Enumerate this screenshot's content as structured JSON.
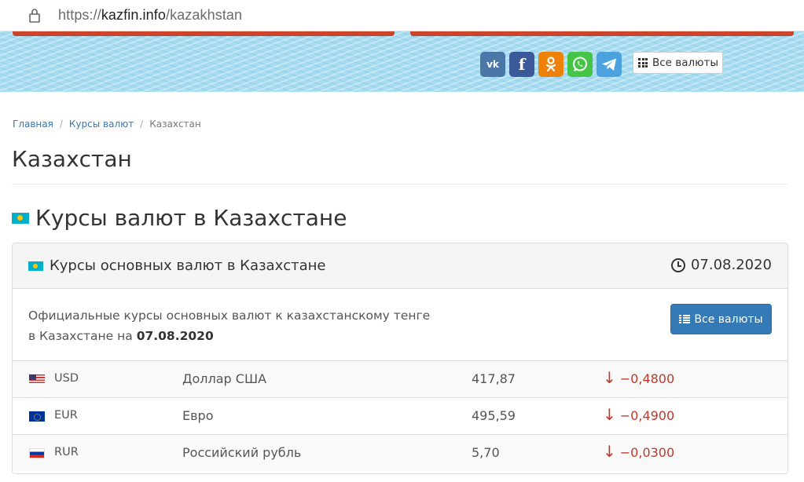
{
  "browser": {
    "url_prefix": "https://",
    "url_host": "kazfin.info",
    "url_path": "/kazakhstan"
  },
  "header": {
    "social": [
      "vk-icon",
      "facebook-icon",
      "odnoklassniki-icon",
      "whatsapp-icon",
      "telegram-icon"
    ],
    "all_currencies_label": "Все валюты"
  },
  "breadcrumb": {
    "items": [
      "Главная",
      "Курсы валют",
      "Казахстан"
    ]
  },
  "page_title": "Казахстан",
  "section_title": "Курсы валют в Казахстане",
  "panel": {
    "title": "Курсы основных валют в Казахстане",
    "date": "07.08.2020",
    "desc_line1": "Официальные курсы основных валют к казахстанскому тенге",
    "desc_line2_prefix": "в Казахстане на ",
    "desc_date": "07.08.2020",
    "button_label": "Все валюты"
  },
  "rates": [
    {
      "code": "USD",
      "name": "Доллар США",
      "value": "417,87",
      "arrow": "↓",
      "change": "−0,4800"
    },
    {
      "code": "EUR",
      "name": "Евро",
      "value": "495,59",
      "arrow": "↓",
      "change": "−0,4900"
    },
    {
      "code": "RUR",
      "name": "Российский рубль",
      "value": "5,70",
      "arrow": "↓",
      "change": "−0,0300"
    }
  ],
  "colors": {
    "banner": "#a9dcf0",
    "accent_red": "#c9452c",
    "button": "#337ab7",
    "change_negative": "#c0392b"
  }
}
